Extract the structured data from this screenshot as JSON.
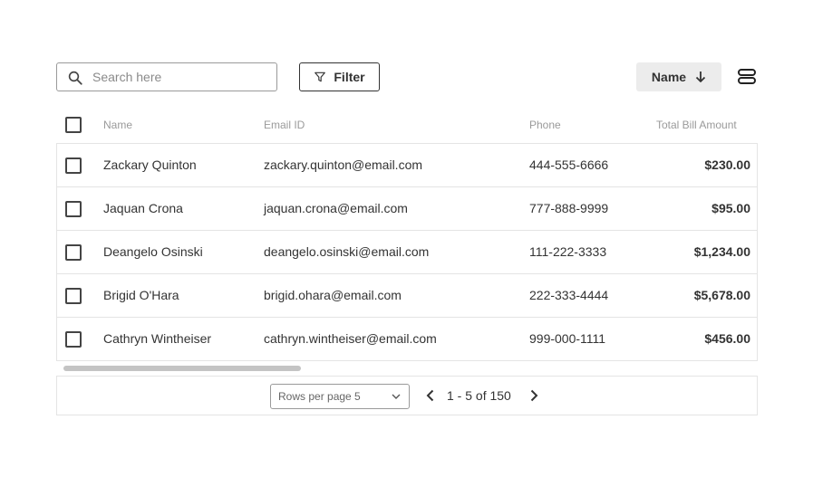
{
  "search": {
    "placeholder": "Search here",
    "value": ""
  },
  "toolbar": {
    "filter_label": "Filter",
    "sort_label": "Name"
  },
  "table": {
    "columns": [
      "Name",
      "Email ID",
      "Phone",
      "Total Bill Amount"
    ],
    "rows": [
      {
        "name": "Zackary Quinton",
        "email": "zackary.quinton@email.com",
        "phone": "444-555-6666",
        "amount": "$230.00"
      },
      {
        "name": "Jaquan Crona",
        "email": "jaquan.crona@email.com",
        "phone": "777-888-9999",
        "amount": "$95.00"
      },
      {
        "name": "Deangelo Osinski",
        "email": "deangelo.osinski@email.com",
        "phone": "111-222-3333",
        "amount": "$1,234.00"
      },
      {
        "name": "Brigid O'Hara",
        "email": "brigid.ohara@email.com",
        "phone": "222-333-4444",
        "amount": "$5,678.00"
      },
      {
        "name": "Cathryn Wintheiser",
        "email": "cathryn.wintheiser@email.com",
        "phone": "999-000-1111",
        "amount": "$456.00"
      }
    ]
  },
  "pagination": {
    "rows_per_page_label": "Rows per page 5",
    "range_text": "1 - 5 of 150"
  },
  "icons": {
    "search": "search-icon",
    "filter": "filter-icon",
    "sort": "arrow-down-icon",
    "density": "density-icon",
    "dropdown": "chevron-down-icon",
    "prev": "chevron-left-icon",
    "next": "chevron-right-icon"
  },
  "colors": {
    "border": "#e4e4e4",
    "text": "#333333",
    "muted": "#9a9a9a",
    "sort_bg": "#ececec"
  }
}
